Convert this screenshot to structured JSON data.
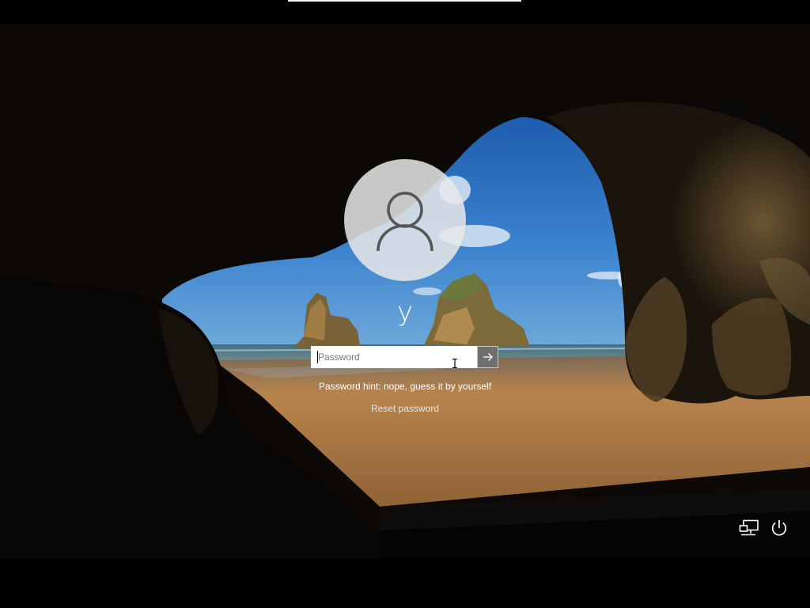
{
  "user": {
    "display_name": "y"
  },
  "password_field": {
    "placeholder": "Password",
    "value": ""
  },
  "submit_button": {
    "icon": "arrow-right-icon"
  },
  "password_hint": "Password hint: nope, guess it by yourself",
  "reset_password_link": "Reset password",
  "corner_buttons": {
    "network_icon": "network-icon",
    "power_icon": "power-icon"
  },
  "colors": {
    "screen_background": "#000000",
    "text": "#ffffff",
    "avatar_circle": "#e8e8e8",
    "submit_button": "#6f6f6f",
    "sky": "#2f72c4",
    "sand": "#b8844d"
  }
}
